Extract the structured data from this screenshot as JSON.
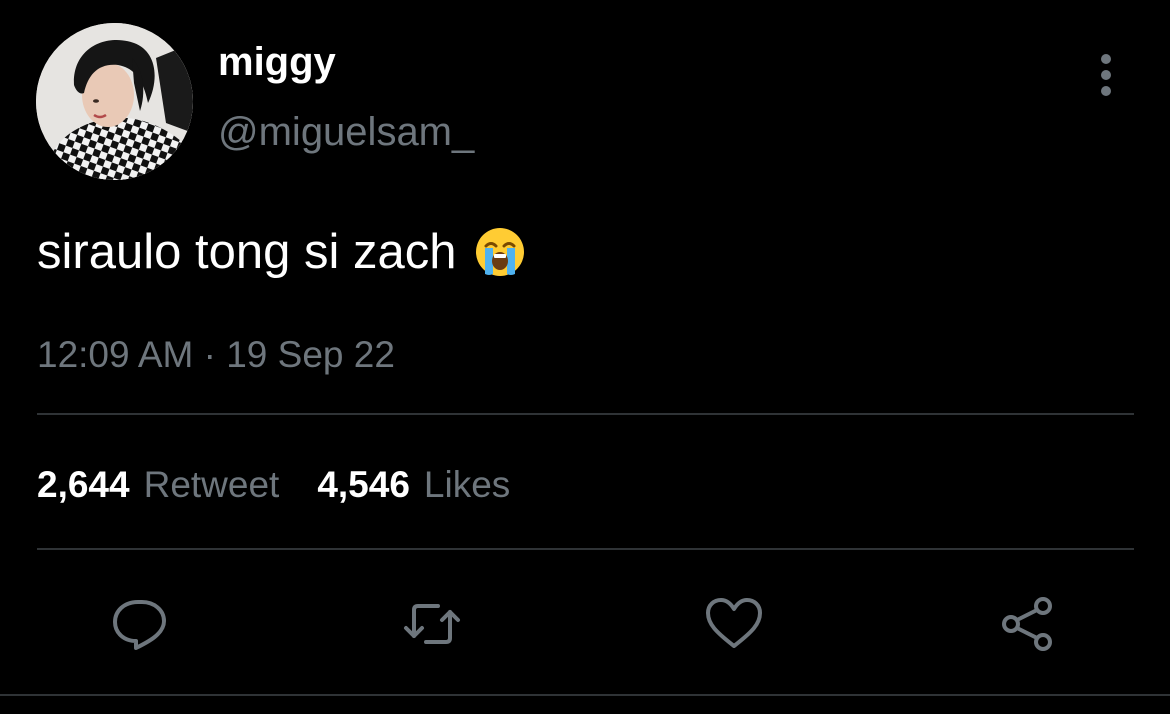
{
  "tweet": {
    "author": {
      "display_name": "miggy",
      "handle": "@miguelsam_",
      "avatar_icon": "profile-photo"
    },
    "text": "siraulo tong si zach",
    "emoji": "loudly-crying-face",
    "timestamp": "12:09 AM · 19 Sep 22",
    "stats": {
      "retweets": {
        "count": "2,644",
        "label": "Retweet"
      },
      "likes": {
        "count": "4,546",
        "label": "Likes"
      }
    },
    "actions": [
      "reply-icon",
      "retweet-icon",
      "like-icon",
      "share-icon"
    ]
  },
  "colors": {
    "background": "#000000",
    "primary_text": "#ffffff",
    "secondary_text": "#6e767d",
    "divider": "#2f3336"
  }
}
